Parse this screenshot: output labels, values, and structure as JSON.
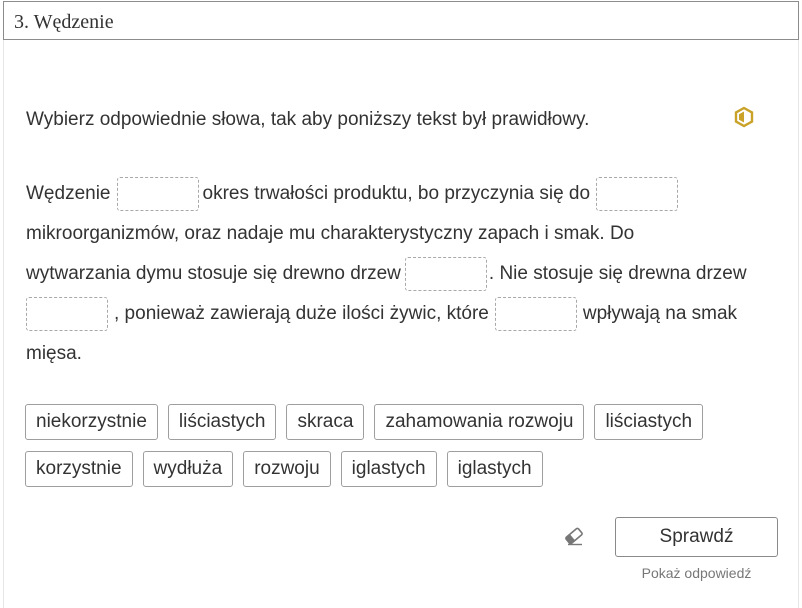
{
  "header": {
    "title": "3. Wędzenie"
  },
  "instruction": "Wybierz odpowiednie słowa, tak aby poniższy tekst był prawidłowy.",
  "passage": {
    "line1": {
      "t1": "Wędzenie",
      "t2": "okres trwałości produktu, bo przyczynia się do"
    },
    "line2": {
      "t1": "mikroorganizmów, oraz nadaje mu charakterystyczny zapach i smak. Do"
    },
    "line3": {
      "t1": "wytwarzania dymu stosuje się drewno drzew",
      "t2": ". Nie stosuje się drewna drzew"
    },
    "line4": {
      "t1": ", ponieważ zawierają duże ilości żywic, które",
      "t2": "wpływają na smak"
    },
    "line5": {
      "t1": "mięsa."
    }
  },
  "chips_row1": [
    "niekorzystnie",
    "liściastych",
    "skraca",
    "zahamowania rozwoju",
    "liściastych"
  ],
  "chips_row2": [
    "korzystnie",
    "wydłuża",
    "rozwoju",
    "iglastych",
    "iglastych"
  ],
  "actions": {
    "check_label": "Sprawdź",
    "show_answer_label": "Pokaż odpowiedź"
  },
  "colors": {
    "hex_icon": "#c9a227"
  },
  "icons": {
    "hint": "hexagon-icon",
    "reset": "eraser-icon"
  }
}
